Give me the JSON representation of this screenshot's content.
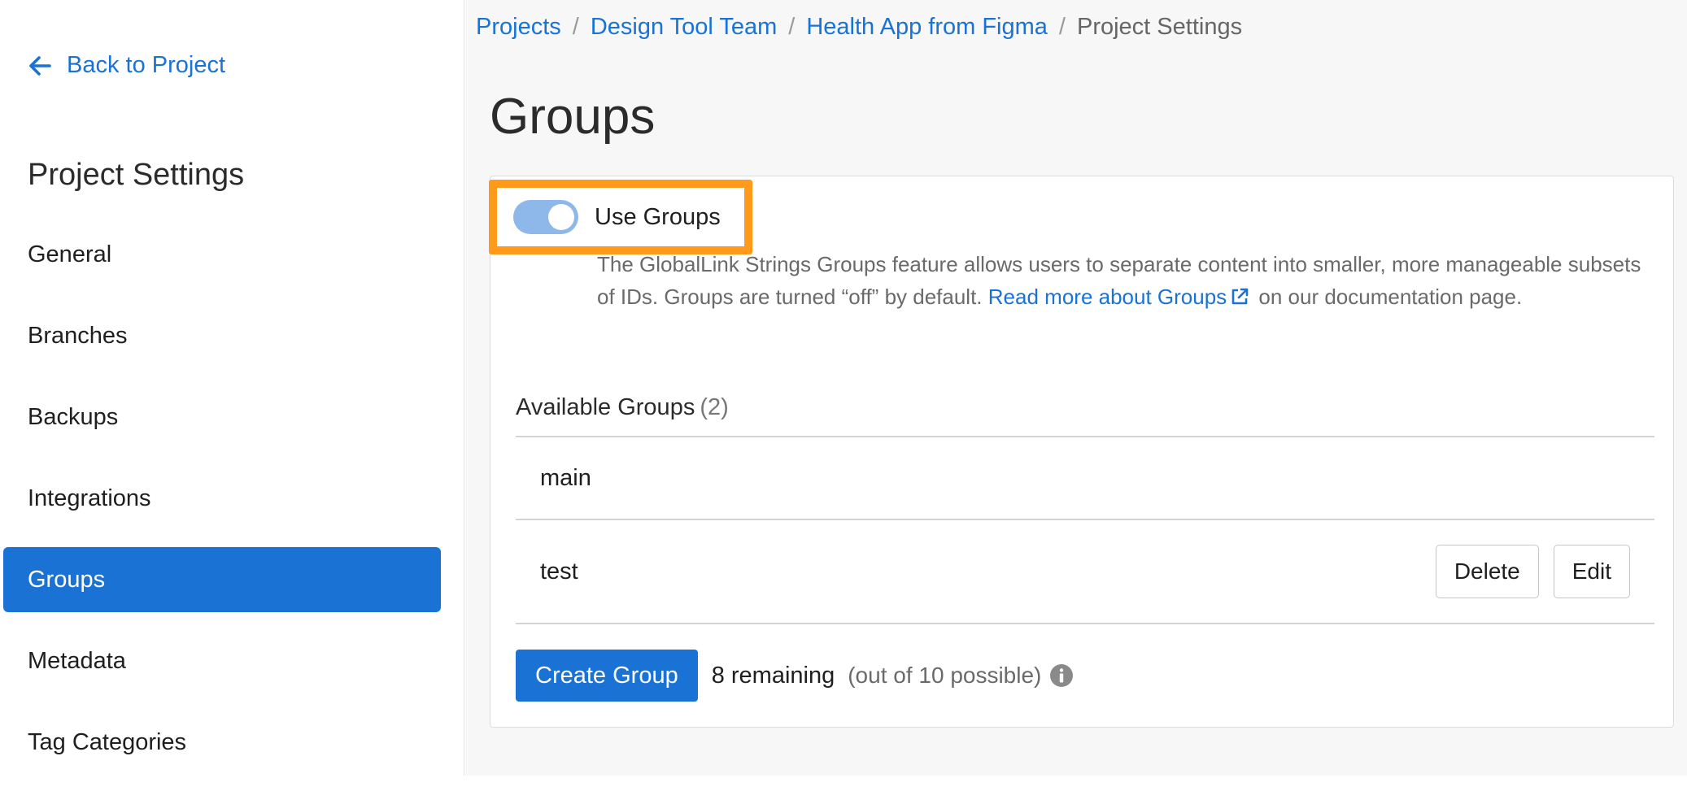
{
  "sidebar": {
    "back_label": "Back to Project",
    "title": "Project Settings",
    "items": [
      {
        "label": "General"
      },
      {
        "label": "Branches"
      },
      {
        "label": "Backups"
      },
      {
        "label": "Integrations"
      },
      {
        "label": "Groups",
        "active": true
      },
      {
        "label": "Metadata"
      },
      {
        "label": "Tag Categories"
      }
    ]
  },
  "breadcrumb": {
    "items": [
      "Projects",
      "Design Tool Team",
      "Health App from Figma"
    ],
    "current": "Project Settings",
    "separator": "/"
  },
  "page": {
    "title": "Groups"
  },
  "groups_toggle": {
    "label": "Use Groups",
    "enabled": true
  },
  "description": {
    "text_before": "The GlobalLink Strings Groups feature allows users to separate content into smaller, more manageable subsets of IDs. Groups are turned “off” by default.",
    "link_text": "Read more about Groups",
    "text_after": "on our documentation page."
  },
  "available_groups": {
    "label": "Available Groups",
    "count": "(2)",
    "rows": [
      {
        "name": "main"
      },
      {
        "name": "test",
        "delete_label": "Delete",
        "edit_label": "Edit"
      }
    ]
  },
  "footer": {
    "create_label": "Create Group",
    "remaining": "8 remaining",
    "possible": "(out of 10 possible)"
  },
  "icons": {
    "back": "arrow-left-icon",
    "external": "external-link-icon",
    "info": "info-circle-icon"
  },
  "colors": {
    "accent": "#1a73d4",
    "highlight": "#ff9a1a",
    "toggle_on": "#8fb8ea"
  }
}
